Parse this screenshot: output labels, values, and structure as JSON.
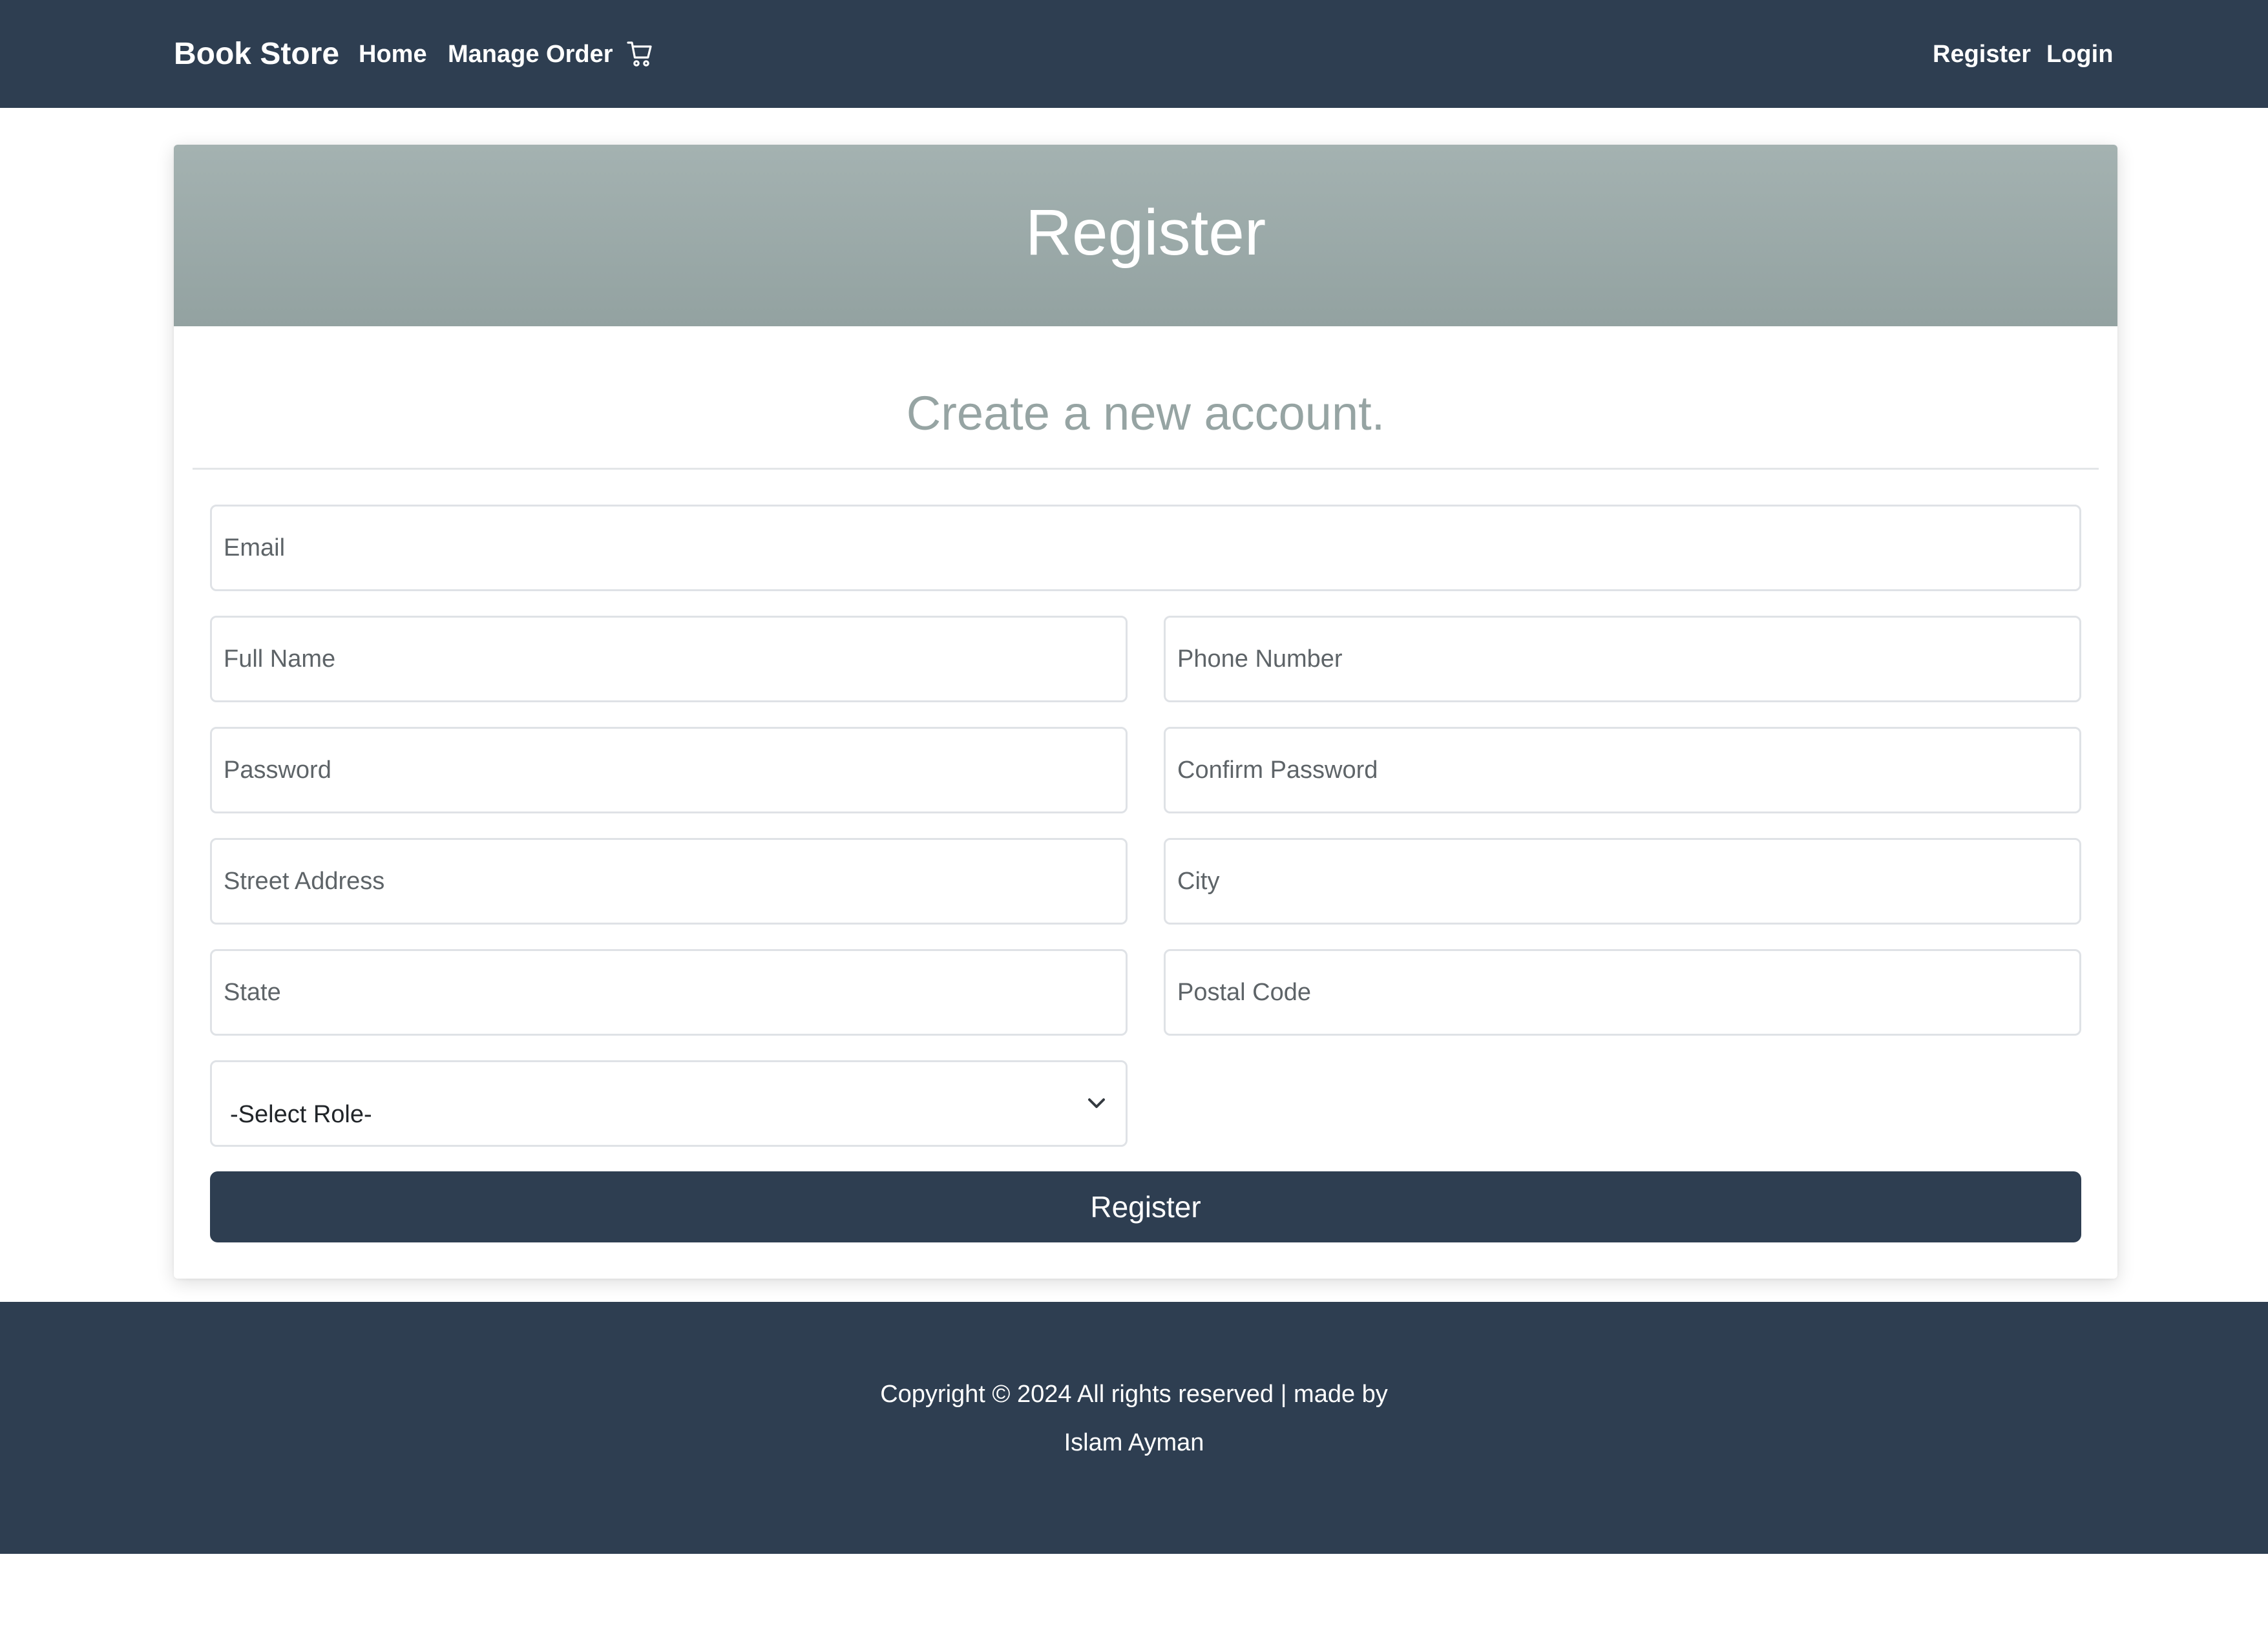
{
  "navbar": {
    "brand": "Book Store",
    "links": {
      "home": "Home",
      "manage_order": "Manage Order",
      "cart_icon": "cart-icon",
      "register": "Register",
      "login": "Login"
    }
  },
  "card": {
    "title": "Register",
    "subtitle": "Create a new account."
  },
  "form": {
    "email": {
      "placeholder": "Email",
      "value": ""
    },
    "full_name": {
      "placeholder": "Full Name",
      "value": ""
    },
    "phone_number": {
      "placeholder": "Phone Number",
      "value": ""
    },
    "password": {
      "placeholder": "Password",
      "value": ""
    },
    "confirm_password": {
      "placeholder": "Confirm Password",
      "value": ""
    },
    "street_address": {
      "placeholder": "Street Address",
      "value": ""
    },
    "city": {
      "placeholder": "City",
      "value": ""
    },
    "state": {
      "placeholder": "State",
      "value": ""
    },
    "postal_code": {
      "placeholder": "Postal Code",
      "value": ""
    },
    "role": {
      "selected": "-Select Role-",
      "icon": "chevron-down-icon"
    },
    "submit_label": "Register"
  },
  "footer": {
    "line1": "Copyright © 2024 All rights reserved | made by",
    "line2": "Islam Ayman"
  },
  "colors": {
    "primary_dark": "#2e3e51",
    "header_gray": "#9eacab",
    "subtitle_gray": "#96a4a3"
  }
}
